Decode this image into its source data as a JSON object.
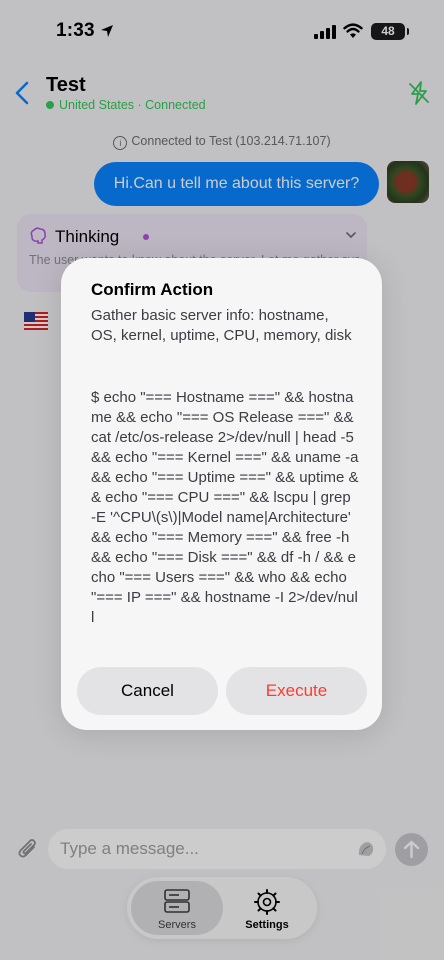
{
  "status_bar": {
    "time": "1:33",
    "battery": "48"
  },
  "nav": {
    "title": "Test",
    "subtitle": "United States · Connected"
  },
  "chat": {
    "connection_note": "Connected to Test (103.214.71.107)",
    "user_message": "Hi.Can u tell me about this server?",
    "thinking_label": "Thinking",
    "thinking_preview": "The user wants to know about the server. Let me gather system info"
  },
  "dialog": {
    "title": "Confirm Action",
    "description": "Gather basic server info: hostname, OS, kernel, uptime, CPU, memory, disk",
    "command": "$ echo \"=== Hostname ===\" && hostname && echo \"=== OS Release ===\" && cat /etc/os-release 2>/dev/null | head -5 && echo \"=== Kernel ===\" && uname -a && echo \"=== Uptime ===\" && uptime && echo \"=== CPU ===\" && lscpu | grep -E '^CPU\\(s\\)|Model name|Architecture' && echo \"=== Memory ===\" && free -h && echo \"=== Disk ===\" && df -h / && echo \"=== Users ===\" && who && echo \"=== IP ===\" && hostname -I 2>/dev/null",
    "cancel_label": "Cancel",
    "execute_label": "Execute"
  },
  "input": {
    "placeholder": "Type a message..."
  },
  "tabs": [
    {
      "label": "Servers"
    },
    {
      "label": "Settings"
    }
  ],
  "colors": {
    "accent": "#0a84ff",
    "connected": "#34c759",
    "danger": "#ff3b30",
    "thinking": "#af52de"
  }
}
